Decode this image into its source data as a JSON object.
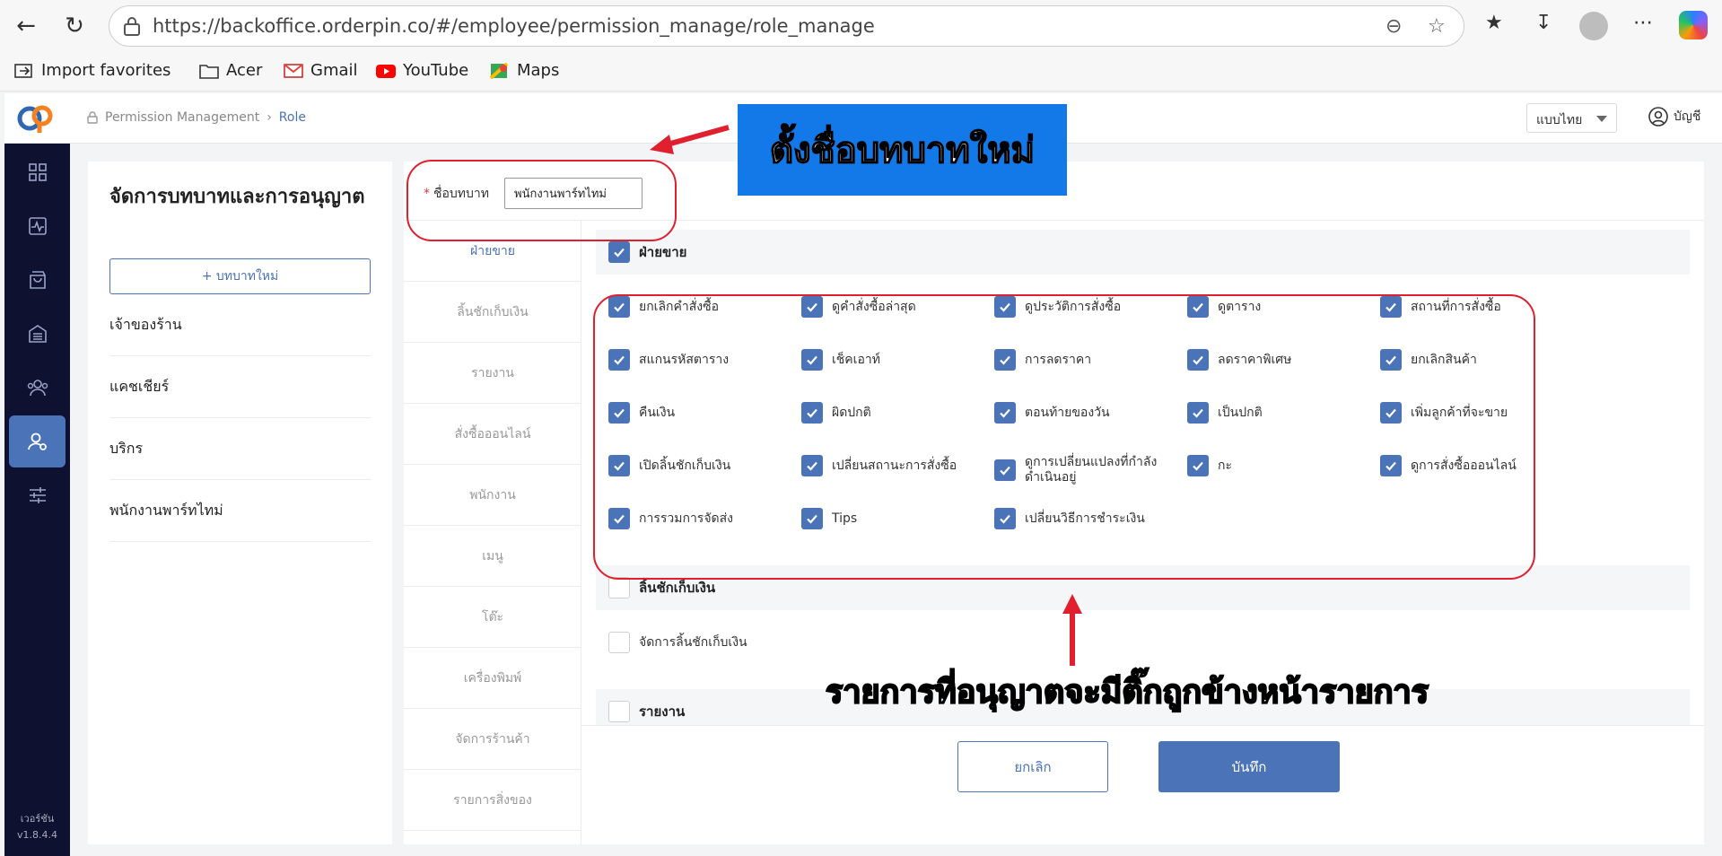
{
  "browser": {
    "url": "https://backoffice.orderpin.co/#/employee/permission_manage/role_manage",
    "bookmarks": [
      "Import favorites",
      "Acer",
      "Gmail",
      "YouTube",
      "Maps"
    ]
  },
  "header": {
    "breadcrumb": [
      "Permission Management",
      "Role"
    ],
    "language": "แบบไทย",
    "account": "บัญชี"
  },
  "sidebar": {
    "version_label": "เวอร์ชัน",
    "version": "v1.8.4.4"
  },
  "roles": {
    "title": "จัดการบทบาทและการอนุญาต",
    "new_role_button": "+ บทบาทใหม่",
    "items": [
      "เจ้าของร้าน",
      "แคชเชียร์",
      "บริกร",
      "พนักงานพาร์ทไทม่"
    ]
  },
  "editor": {
    "name_label": "ชื่อบทบาท",
    "name_required": "*",
    "name_value": "พนักงานพาร์ทไทม่",
    "categories": [
      "ฝ่ายขาย",
      "ลิ้นชักเก็บเงิน",
      "รายงาน",
      "สั่งซื้อออนไลน์",
      "พนักงาน",
      "เมนู",
      "โต๊ะ",
      "เครื่องพิมพ์",
      "จัดการร้านค้า",
      "รายการสิ่งของ"
    ],
    "groups": [
      {
        "title": "ฝ่ายขาย",
        "checked": true,
        "permissions": [
          {
            "label": "ยกเลิกคำสั่งซื้อ",
            "checked": true
          },
          {
            "label": "ดูคำสั่งซื้อล่าสุด",
            "checked": true
          },
          {
            "label": "ดูประวัติการสั่งซื้อ",
            "checked": true
          },
          {
            "label": "ดูตาราง",
            "checked": true
          },
          {
            "label": "สถานที่การสั่งซื้อ",
            "checked": true
          },
          {
            "label": "สแกนรหัสตาราง",
            "checked": true
          },
          {
            "label": "เช็คเอาท์",
            "checked": true
          },
          {
            "label": "การลดราคา",
            "checked": true
          },
          {
            "label": "ลดราคาพิเศษ",
            "checked": true
          },
          {
            "label": "ยกเลิกสินค้า",
            "checked": true
          },
          {
            "label": "คืนเงิน",
            "checked": true
          },
          {
            "label": "ผิดปกติ",
            "checked": true
          },
          {
            "label": "ตอนท้ายของวัน",
            "checked": true
          },
          {
            "label": "เป็นปกติ",
            "checked": true
          },
          {
            "label": "เพิ่มลูกค้าที่จะขาย",
            "checked": true
          },
          {
            "label": "เปิดลิ้นชักเก็บเงิน",
            "checked": true
          },
          {
            "label": "เปลี่ยนสถานะการสั่งซื้อ",
            "checked": true
          },
          {
            "label": "ดูการเปลี่ยนแปลงที่กำลังดำเนินอยู่",
            "checked": true
          },
          {
            "label": "กะ",
            "checked": true
          },
          {
            "label": "ดูการสั่งซื้อออนไลน์",
            "checked": true
          },
          {
            "label": "การรวมการจัดส่ง",
            "checked": true
          },
          {
            "label": "Tips",
            "checked": true
          },
          {
            "label": "เปลี่ยนวิธีการชำระเงิน",
            "checked": true
          }
        ]
      },
      {
        "title": "ลิ้นชักเก็บเงิน",
        "checked": false,
        "permissions": [
          {
            "label": "จัดการลิ้นชักเก็บเงิน",
            "checked": false
          }
        ]
      },
      {
        "title": "รายงาน",
        "checked": false,
        "permissions": []
      }
    ],
    "cancel_button": "ยกเลิก",
    "save_button": "บันทึก"
  },
  "annotations": {
    "banner": "ตั้งชื่อบทบาทใหม่",
    "caption": "รายการที่อนุญาตจะมีติ๊กถูกข้างหน้ารายการ"
  },
  "colors": {
    "accent": "#4a73b8",
    "sidebar": "#0e1130",
    "annotation_red": "#e0202e",
    "banner_blue": "#1479e8"
  }
}
